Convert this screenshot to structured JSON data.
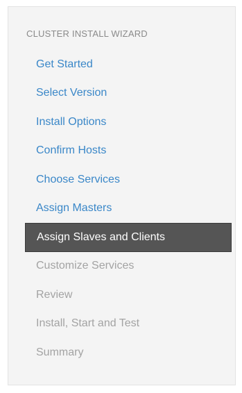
{
  "wizard": {
    "title": "CLUSTER INSTALL WIZARD",
    "steps": [
      {
        "label": "Get Started",
        "state": "completed"
      },
      {
        "label": "Select Version",
        "state": "completed"
      },
      {
        "label": "Install Options",
        "state": "completed"
      },
      {
        "label": "Confirm Hosts",
        "state": "completed"
      },
      {
        "label": "Choose Services",
        "state": "completed"
      },
      {
        "label": "Assign Masters",
        "state": "completed"
      },
      {
        "label": "Assign Slaves and Clients",
        "state": "active"
      },
      {
        "label": "Customize Services",
        "state": "pending"
      },
      {
        "label": "Review",
        "state": "pending"
      },
      {
        "label": "Install, Start and Test",
        "state": "pending"
      },
      {
        "label": "Summary",
        "state": "pending"
      }
    ]
  },
  "colors": {
    "link": "#3a87c8",
    "active_bg": "#555555",
    "pending": "#a3a3a3",
    "panel_bg": "#f4f4f4"
  }
}
